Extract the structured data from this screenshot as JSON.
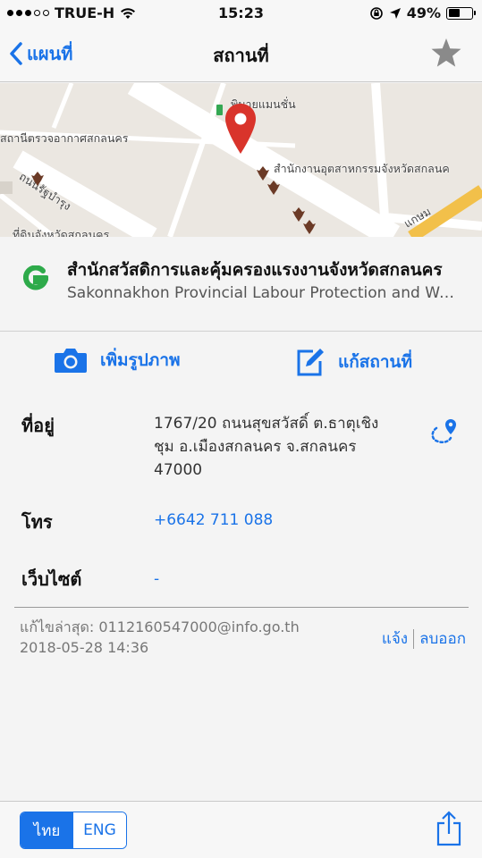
{
  "status": {
    "carrier": "TRUE-H",
    "time": "15:23",
    "battery": "49%",
    "battery_level": 0.49
  },
  "nav": {
    "back_label": "แผนที่",
    "title": "สถานที่"
  },
  "map": {
    "labels": [
      "พิมายแมนชั่น",
      "สถานีตรวจอากาศสกลนคร",
      "ถนนรัฐบำรุง",
      "สำนักงานอุตสาหกรรมจังหวัดสกลนค",
      "ที่ดินจังหวัดสกลนคร",
      "แกษม"
    ]
  },
  "place": {
    "name_th": "สำนักสวัสดิการและคุ้มครองแรงงานจังหวัดสกลนคร",
    "name_en": "Sakonnakhon Provincial Labour Protection and Welfare Office"
  },
  "actions": {
    "add_photo": "เพิ่มรูปภาพ",
    "edit_place": "แก้สถานที่"
  },
  "details": {
    "address_label": "ที่อยู่",
    "address_line1": "1767/20 ถนนสุขสวัสดิ์ ต.ธาตุเชิง",
    "address_line2": "ชุม อ.เมืองสกลนคร จ.สกลนคร",
    "address_line3": "47000",
    "phone_label": "โทร",
    "phone": "+6642 711 088",
    "website_label": "เว็บไซต์",
    "website": "-"
  },
  "meta": {
    "edited_by": "แก้ไขล่าสุด: 0112160547000@info.go.th",
    "edited_at": "2018-05-28 14:36",
    "report": "แจ้ง",
    "delete": "ลบออก"
  },
  "bottom": {
    "lang_th": "ไทย",
    "lang_en": "ENG"
  },
  "colors": {
    "accent": "#1a73e8",
    "pin": "#d9342b"
  }
}
